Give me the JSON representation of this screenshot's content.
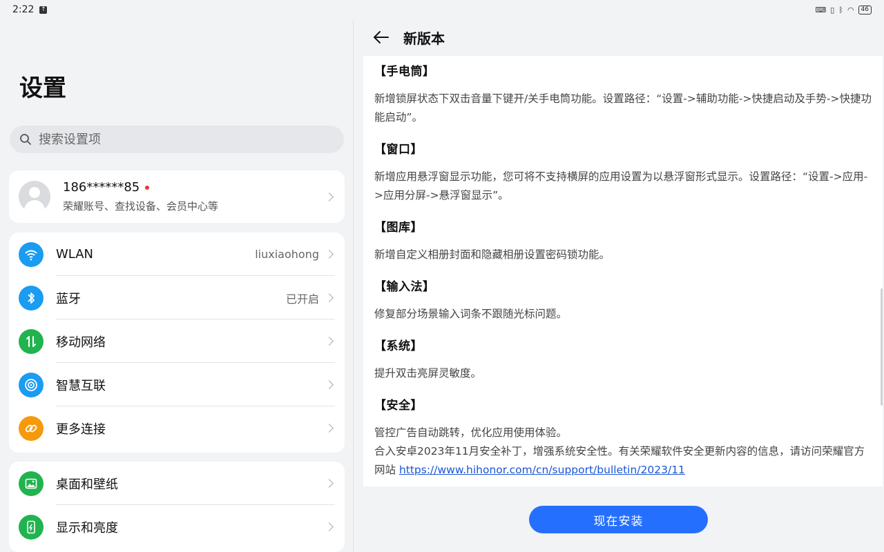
{
  "statusbar": {
    "time": "2:22",
    "battery": "46"
  },
  "left": {
    "title": "设置",
    "search_placeholder": "搜索设置项",
    "account": {
      "name": "186******85",
      "subtitle": "荣耀账号、查找设备、会员中心等"
    },
    "items": [
      {
        "label": "WLAN",
        "value": "liuxiaohong",
        "icon": "wifi-icon",
        "color": "#1a9cf0"
      },
      {
        "label": "蓝牙",
        "value": "已开启",
        "icon": "bluetooth-icon",
        "color": "#1a9cf0"
      },
      {
        "label": "移动网络",
        "value": "",
        "icon": "mobile-data-icon",
        "color": "#21b34f"
      },
      {
        "label": "智慧互联",
        "value": "",
        "icon": "smart-connect-icon",
        "color": "#1a9cf0"
      },
      {
        "label": "更多连接",
        "value": "",
        "icon": "link-icon",
        "color": "#f59a0d"
      }
    ],
    "items2": [
      {
        "label": "桌面和壁纸",
        "icon": "image-icon",
        "color": "#21b34f"
      },
      {
        "label": "显示和亮度",
        "icon": "phone-brightness-icon",
        "color": "#21b34f"
      }
    ]
  },
  "right": {
    "title": "新版本",
    "sections": [
      {
        "title": "【手电筒】",
        "text": "新增锁屏状态下双击音量下键开/关手电筒功能。设置路径：“设置->辅助功能->快捷启动及手势->快捷功能启动”。"
      },
      {
        "title": "【窗口】",
        "text": "新增应用悬浮窗显示功能，您可将不支持横屏的应用设置为以悬浮窗形式显示。设置路径：“设置->应用->应用分屏->悬浮窗显示”。"
      },
      {
        "title": "【图库】",
        "text": "新增自定义相册封面和隐藏相册设置密码锁功能。"
      },
      {
        "title": "【输入法】",
        "text": "修复部分场景输入词条不跟随光标问题。"
      },
      {
        "title": "【系统】",
        "text": "提升双击亮屏灵敏度。"
      },
      {
        "title": "【安全】",
        "text": "管控广告自动跳转，优化应用使用体验。",
        "text2": "合入安卓2023年11月安全补丁，增强系统安全性。有关荣耀软件安全更新内容的信息，请访问荣耀官方网站 ",
        "link": "https://www.hihonor.com/cn/support/bulletin/2023/11"
      }
    ],
    "install_label": "现在安装"
  }
}
